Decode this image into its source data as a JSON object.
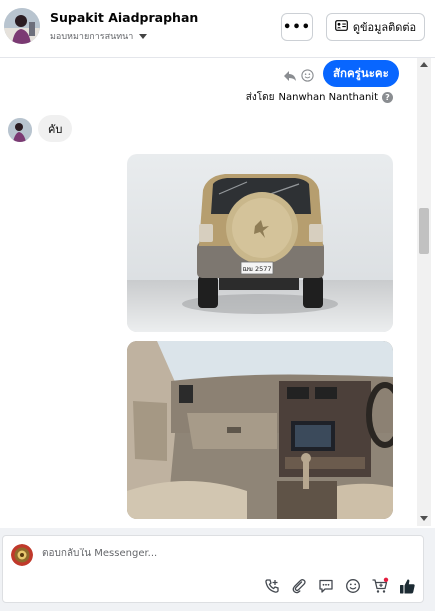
{
  "header": {
    "contact_name": "Supakit Aiadpraphan",
    "assignee_label": "มอบหมายการสนทนา",
    "more_label": "•••",
    "info_button_label": "ดูข้อมูลติดต่อ"
  },
  "thread": {
    "sent_message": "สักครู่นะคะ",
    "sent_by_prefix": "ส่งโดย",
    "sent_by_name": "Nanwhan Nanthanit",
    "help_label": "?",
    "received_message": "คับ",
    "photo1_plate": "ฌฆ 2577"
  },
  "composer": {
    "placeholder": "ตอบกลับใน Messenger..."
  },
  "colors": {
    "accent": "#0866ff",
    "send_like": "#1c2b33"
  },
  "icons": [
    "more-icon",
    "contact-card-icon",
    "reply-icon",
    "react-icon",
    "help-icon",
    "call-icon",
    "attach-icon",
    "saved-replies-icon",
    "emoji-icon",
    "shop-icon",
    "like-icon"
  ]
}
